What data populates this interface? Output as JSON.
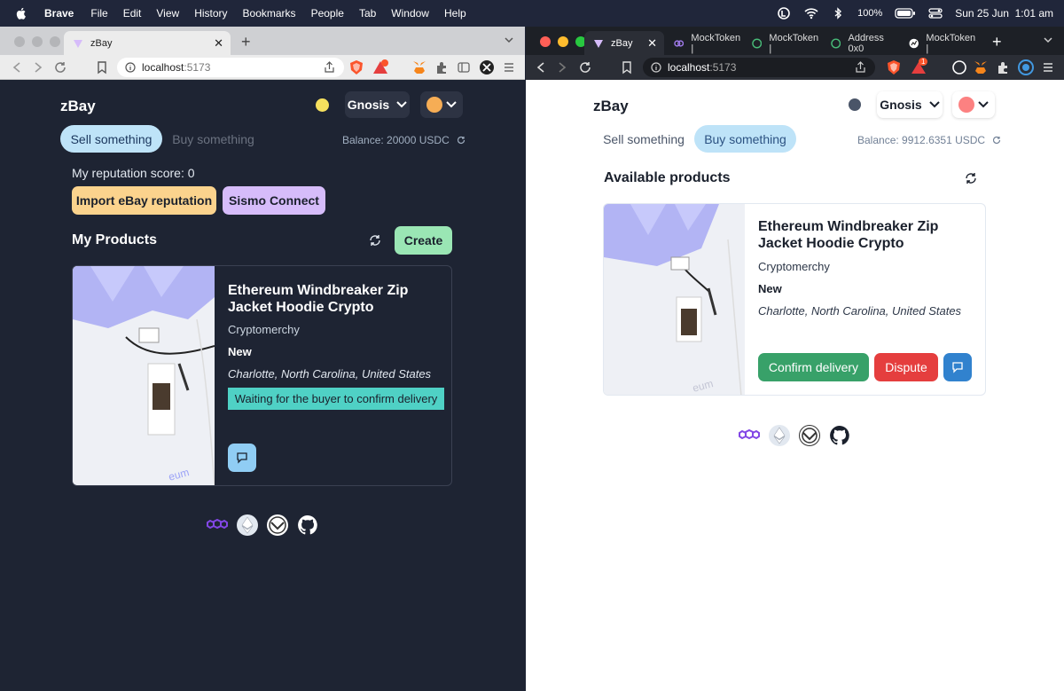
{
  "menubar": {
    "app": "Brave",
    "items": [
      "File",
      "Edit",
      "View",
      "History",
      "Bookmarks",
      "People",
      "Tab",
      "Window",
      "Help"
    ],
    "battery": "100%",
    "datetime": "Sun 25 Jun  1:01 am"
  },
  "left_window": {
    "tab_title": "zBay",
    "url_host": "localhost",
    "url_port": ":5173",
    "brand": "zBay",
    "network": "Gnosis",
    "tabs": [
      "Sell something",
      "Buy something"
    ],
    "balance": "Balance: 20000 USDC",
    "reputation": "My reputation score: 0",
    "import_button": "Import eBay reputation",
    "sismo_button": "Sismo Connect",
    "section_title": "My Products",
    "create_button": "Create",
    "product": {
      "title": "Ethereum Windbreaker Zip Jacket Hoodie Crypto",
      "seller": "Cryptomerchy",
      "condition": "New",
      "location": "Charlotte, North Carolina, United States",
      "status": "Waiting for the buyer to confirm delivery",
      "image_text": "eum"
    }
  },
  "right_window": {
    "tabs": [
      {
        "title": "zBay"
      },
      {
        "title": "MockToken |"
      },
      {
        "title": "MockToken |"
      },
      {
        "title": "Address 0x0"
      },
      {
        "title": "MockToken |"
      }
    ],
    "url_host": "localhost",
    "url_port": ":5173",
    "shield_badge": "1",
    "brand": "zBay",
    "network": "Gnosis",
    "tabs_app": [
      "Sell something",
      "Buy something"
    ],
    "balance": "Balance: 9912.6351 USDC",
    "section_title": "Available products",
    "product": {
      "title": "Ethereum Windbreaker Zip Jacket Hoodie Crypto",
      "seller": "Cryptomerchy",
      "condition": "New",
      "location": "Charlotte, North Carolina, United States",
      "confirm_button": "Confirm delivery",
      "dispute_button": "Dispute",
      "image_text": "eum"
    }
  },
  "colors": {
    "dark_bg": "#1e2433",
    "sell_active": "#bee3f8",
    "import_btn": "#fbd38d",
    "sismo_btn": "#d6bcfa",
    "create_btn": "#9ae6b4",
    "status_bg": "#4fd1c5",
    "confirm_btn": "#38a169",
    "dispute_btn": "#e53e3e",
    "chat_btn": "#3182ce"
  },
  "icons": [
    "polygon-icon",
    "ethereum-icon",
    "gnosis-icon",
    "github-icon"
  ]
}
